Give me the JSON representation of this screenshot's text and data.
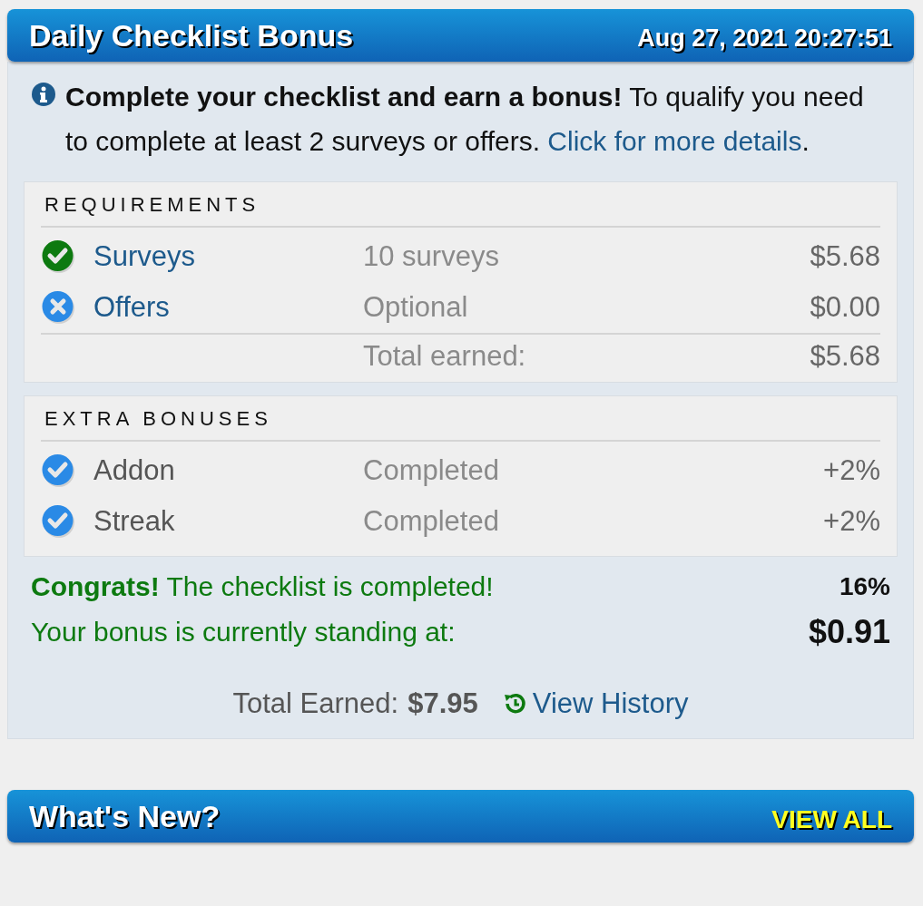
{
  "header": {
    "title": "Daily Checklist Bonus",
    "timestamp": "Aug 27, 2021 20:27:51"
  },
  "intro": {
    "text": "**Complete your checklist and earn a bonus!** To qualify you need to complete at least 2 surveys or offers.",
    "link": "Click for more details",
    "after_link": "."
  },
  "requirements": {
    "heading": "REQUIREMENTS",
    "rows": [
      {
        "name": "Surveys",
        "detail": "10 surveys",
        "amount": "$5.68",
        "completed": true
      },
      {
        "name": "Offers",
        "detail": "Optional",
        "amount": "$0.00",
        "completed": false
      }
    ],
    "total_label": "Total earned:",
    "total_value": "$5.68"
  },
  "extra_bonuses": {
    "heading": "EXTRA BONUSES",
    "rows": [
      {
        "name": "Addon",
        "detail": "Completed",
        "amount": "+2%",
        "completed": true
      },
      {
        "name": "Streak",
        "detail": "Completed",
        "amount": "+2%",
        "completed": true
      }
    ]
  },
  "status": {
    "message": "**Congrats!** The checklist is completed!",
    "percent": "16%",
    "bonus_label": "Your bonus is currently standing at:",
    "bonus_value": "$0.91"
  },
  "footer": {
    "total_label": "Total Earned:",
    "total_value": "$7.95",
    "history_link": "View History"
  },
  "whats_new": {
    "title": "What's New?",
    "action": "VIEW ALL"
  }
}
